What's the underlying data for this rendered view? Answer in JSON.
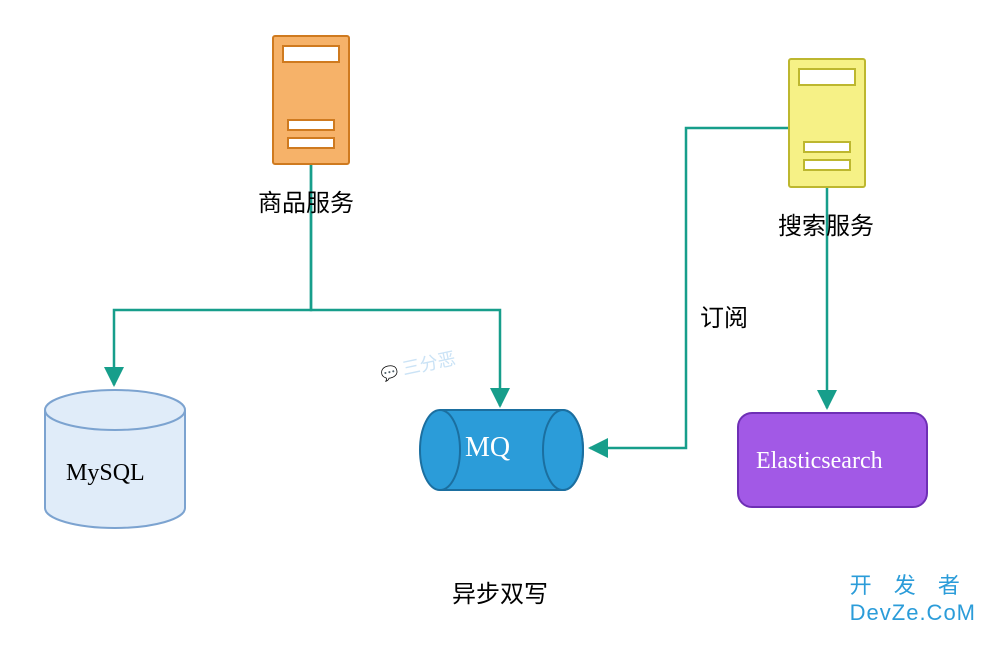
{
  "nodes": {
    "product_service": {
      "label": "商品服务"
    },
    "search_service": {
      "label": "搜索服务"
    },
    "mysql": {
      "label": "MySQL"
    },
    "mq": {
      "label": "MQ"
    },
    "elasticsearch": {
      "label": "Elasticsearch"
    }
  },
  "edges": {
    "subscribe": {
      "label": "订阅"
    }
  },
  "caption": "异步双写",
  "watermark": "三分恶",
  "brand": {
    "top": "开 发 者",
    "bottom": "DevZe.CoM"
  }
}
